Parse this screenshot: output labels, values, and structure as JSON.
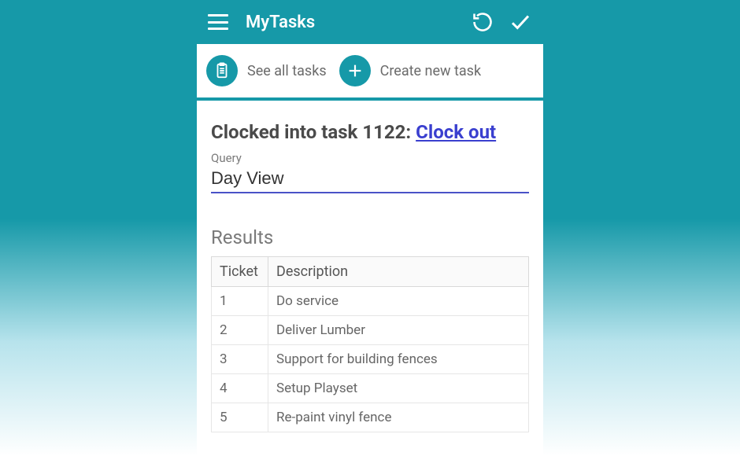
{
  "header": {
    "title": "MyTasks"
  },
  "toolbar": {
    "see_all_label": "See all tasks",
    "create_label": "Create new task"
  },
  "clocked": {
    "prefix": "Clocked into task 1122: ",
    "link": "Clock out"
  },
  "query": {
    "label": "Query",
    "value": "Day View"
  },
  "results": {
    "heading": "Results",
    "columns": {
      "ticket": "Ticket",
      "description": "Description"
    },
    "rows": [
      {
        "ticket": "1",
        "description": "Do service"
      },
      {
        "ticket": "2",
        "description": "Deliver Lumber"
      },
      {
        "ticket": "3",
        "description": "Support for building fences"
      },
      {
        "ticket": "4",
        "description": "Setup Playset"
      },
      {
        "ticket": "5",
        "description": "Re-paint vinyl fence"
      }
    ]
  }
}
